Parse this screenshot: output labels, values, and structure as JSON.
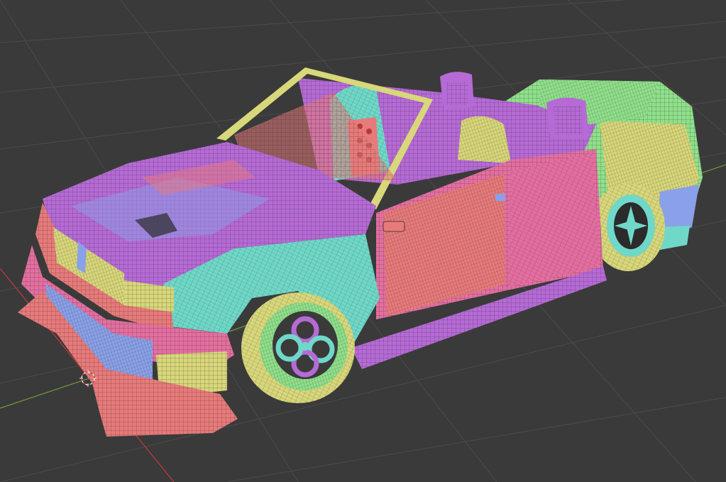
{
  "viewport": {
    "background": "#3a3a3a",
    "grid_color": "#4a4a4a",
    "x_axis_color": "#b23a3a",
    "y_axis_color": "#6e9a3a",
    "object": "car-wireframe",
    "colors": {
      "purple": "#b66ad6",
      "cyan": "#6fd8c8",
      "salmon": "#e87a7a",
      "pink": "#e46ea0",
      "yellow": "#d8d77a",
      "green": "#8fe08a",
      "blue": "#8aa0e8",
      "wire": "#2b2b2b"
    }
  }
}
